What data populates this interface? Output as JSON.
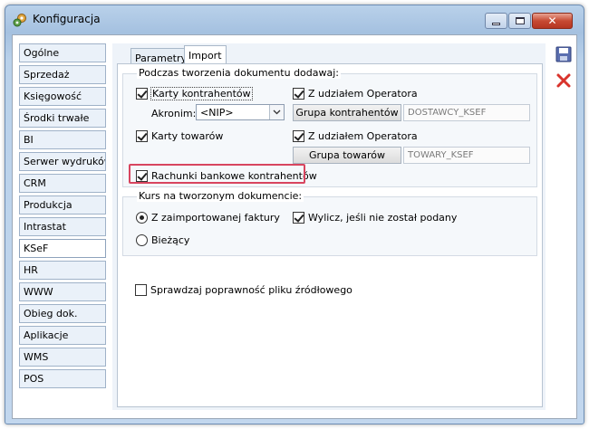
{
  "window": {
    "title": "Konfiguracja"
  },
  "nav": {
    "items": [
      {
        "label": "Ogólne"
      },
      {
        "label": "Sprzedaż"
      },
      {
        "label": "Księgowość"
      },
      {
        "label": "Środki trwałe"
      },
      {
        "label": "BI"
      },
      {
        "label": "Serwer wydruków"
      },
      {
        "label": "CRM"
      },
      {
        "label": "Produkcja"
      },
      {
        "label": "Intrastat"
      },
      {
        "label": "KSeF"
      },
      {
        "label": "HR"
      },
      {
        "label": "WWW"
      },
      {
        "label": "Obieg dok."
      },
      {
        "label": "Aplikacje"
      },
      {
        "label": "WMS"
      },
      {
        "label": "POS"
      }
    ],
    "active": "KSeF"
  },
  "tabs": {
    "parametry": "Parametry",
    "import": "Import"
  },
  "doc_group": {
    "title": "Podczas tworzenia dokumentu dodawaj:",
    "karty_kontrahentow": {
      "label": "Karty kontrahentów",
      "checked": true
    },
    "akronim_label": "Akronim:",
    "akronim_value": "<NIP>",
    "z_udzialem_1": {
      "label": "Z udziałem Operatora",
      "checked": true
    },
    "grupa_kontrahentow_button": "Grupa kontrahentów",
    "grupa_kontrahentow_value": "DOSTAWCY_KSEF",
    "karty_towarow": {
      "label": "Karty towarów",
      "checked": true
    },
    "z_udzialem_2": {
      "label": "Z udziałem Operatora",
      "checked": true
    },
    "grupa_towarow_button": "Grupa towarów",
    "grupa_towarow_value": "TOWARY_KSEF",
    "rachunki": {
      "label": "Rachunki bankowe kontrahentów",
      "checked": true
    }
  },
  "kurs_group": {
    "title": "Kurs na tworzonym dokumencie:",
    "z_faktury": {
      "label": "Z zaimportowanej faktury",
      "selected": true
    },
    "biezacy": {
      "label": "Bieżący",
      "selected": false
    },
    "wylicz": {
      "label": "Wylicz, jeśli nie został podany",
      "checked": true
    }
  },
  "sprawdzaj": {
    "label": "Sprawdzaj poprawność pliku źródłowego",
    "checked": false
  },
  "colors": {
    "highlight": "#d8455f",
    "save_icon": "#5b6fb0",
    "delete_icon": "#d9332c"
  }
}
